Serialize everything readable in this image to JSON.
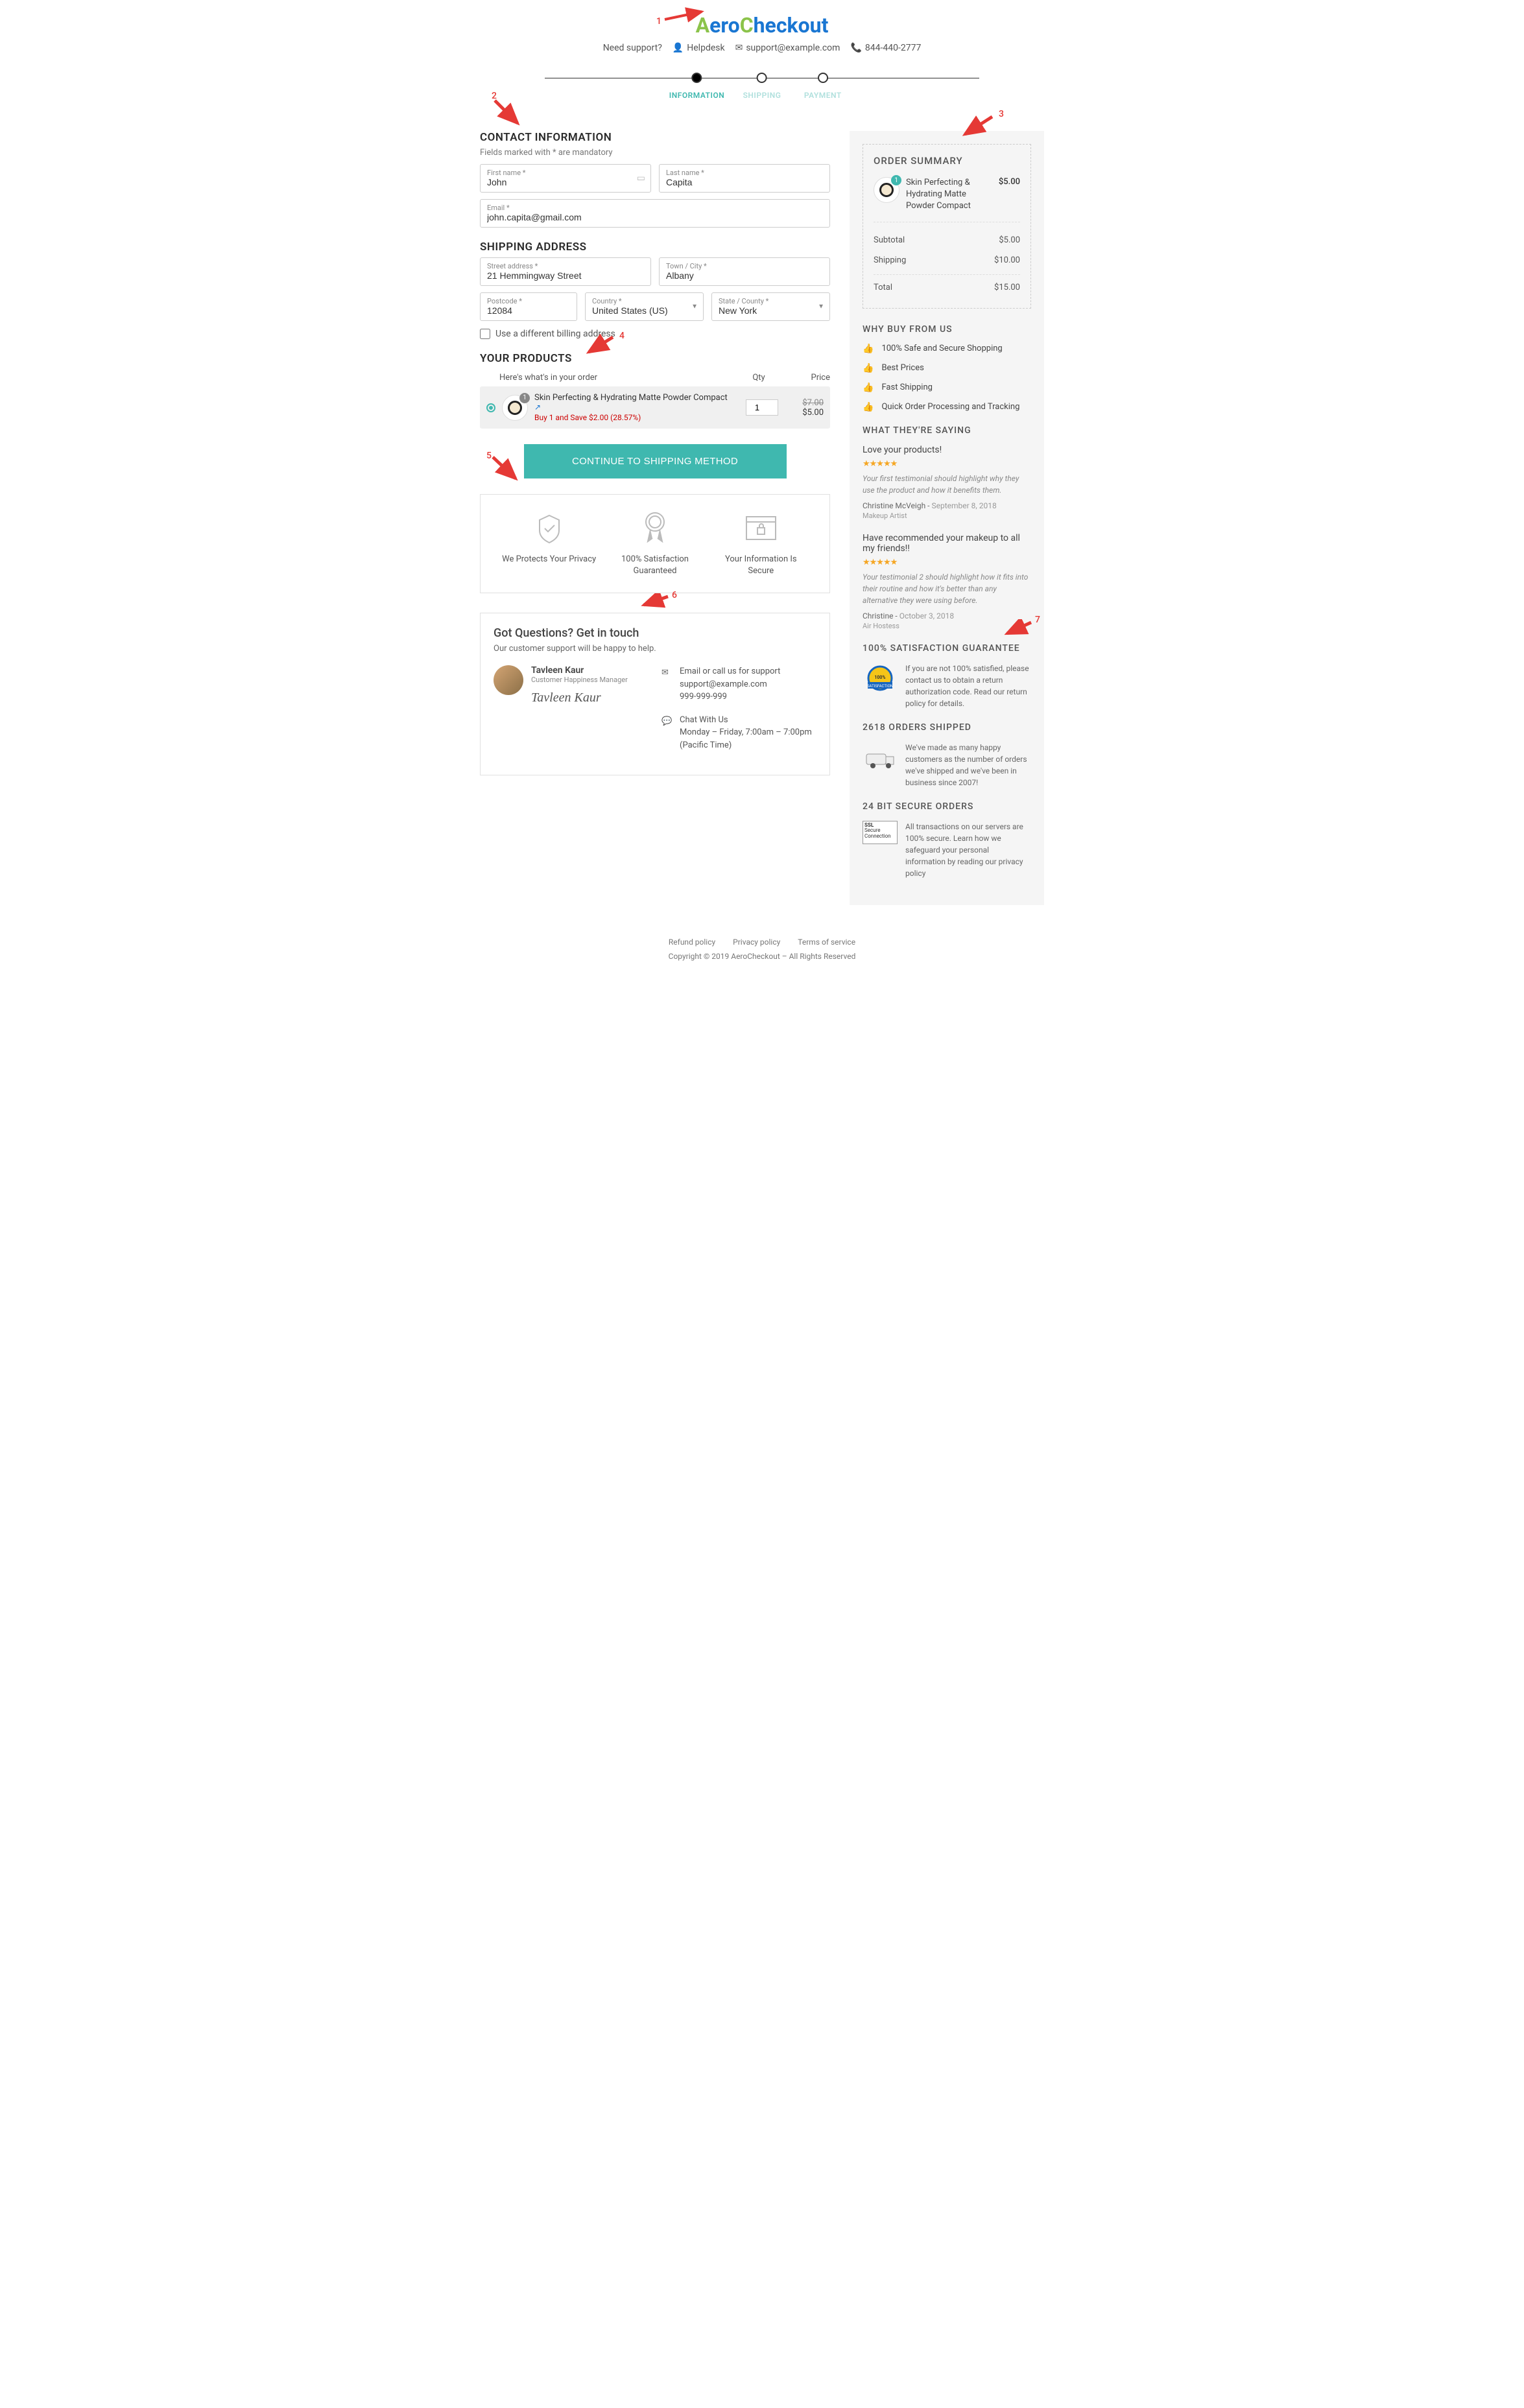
{
  "logo": {
    "a": "A",
    "rest1": "ero",
    "c": "C",
    "rest2": "heckout"
  },
  "support": {
    "need": "Need support?",
    "helpdesk": "Helpdesk",
    "email": "support@example.com",
    "phone": "844-440-2777"
  },
  "steps": {
    "s1": "INFORMATION",
    "s2": "SHIPPING",
    "s3": "PAYMENT"
  },
  "contact": {
    "title": "CONTACT INFORMATION",
    "hint": "Fields marked with * are mandatory",
    "fn_label": "First name *",
    "fn": "John",
    "ln_label": "Last name *",
    "ln": "Capita",
    "em_label": "Email *",
    "em": "john.capita@gmail.com"
  },
  "shipping": {
    "title": "SHIPPING ADDRESS",
    "street_label": "Street address *",
    "street": "21 Hemmingway Street",
    "city_label": "Town / City *",
    "city": "Albany",
    "zip_label": "Postcode *",
    "zip": "12084",
    "country_label": "Country *",
    "country": "United States (US)",
    "state_label": "State / County *",
    "state": "New York",
    "chk": "Use a different billing address"
  },
  "products": {
    "title": "YOUR PRODUCTS",
    "hint": "Here's what's in your order",
    "qty_h": "Qty",
    "price_h": "Price",
    "item": {
      "name": "Skin Perfecting & Hydrating Matte Powder Compact",
      "badge": "1",
      "deal": "Buy 1 and Save $2.00 (28.57%)",
      "qty": "1",
      "old": "$7.00",
      "new": "$5.00"
    }
  },
  "cta": "CONTINUE TO SHIPPING METHOD",
  "trust": {
    "t1": "We Protects Your Privacy",
    "t2": "100% Satisfaction Guaranteed",
    "t3": "Your Information Is Secure"
  },
  "contactbox": {
    "title": "Got Questions? Get in touch",
    "sub": "Our customer support will be happy to help.",
    "name": "Tavleen Kaur",
    "role": "Customer Happiness Manager",
    "sig": "Tavleen Kaur",
    "m1_t": "Email or call us for support",
    "m1_e": "support@example.com",
    "m1_p": "999-999-999",
    "m2_t": "Chat With Us",
    "m2_h": "Monday – Friday, 7:00am – 7:00pm (Pacific Time)"
  },
  "summary": {
    "title": "ORDER SUMMARY",
    "badge": "1",
    "item": "Skin Perfecting & Hydrating Matte Powder Compact",
    "item_p": "$5.00",
    "sub_l": "Subtotal",
    "sub_v": "$5.00",
    "ship_l": "Shipping",
    "ship_v": "$10.00",
    "tot_l": "Total",
    "tot_v": "$15.00"
  },
  "why": {
    "title": "WHY BUY FROM US",
    "i1": "100% Safe and Secure Shopping",
    "i2": "Best Prices",
    "i3": "Fast Shipping",
    "i4": "Quick Order Processing and Tracking"
  },
  "say": {
    "title": "WHAT THEY'RE SAYING",
    "t1": {
      "title": "Love your products!",
      "body": "Your first testimonial should highlight why they use the product and how it benefits them.",
      "author": "Christine McVeigh",
      "date": "September 8, 2018",
      "role": "Makeup Artist"
    },
    "t2": {
      "title": "Have recommended your makeup to all my friends!!",
      "body": "Your testimonial 2 should highlight how it fits into their routine and how it's better than any alternative they were using before.",
      "author": "Christine",
      "date": "October 3, 2018",
      "role": "Air Hostess"
    }
  },
  "sat": {
    "title": "100% SATISFACTION GUARANTEE",
    "body": "If you are not 100% satisfied, please contact us to obtain a return authorization code. Read our return policy for details."
  },
  "ship_info": {
    "title": "2618 ORDERS SHIPPED",
    "body": "We've made as many happy customers as the number of orders we've shipped and we've been in business since 2007!"
  },
  "secure": {
    "title": "24 BIT SECURE ORDERS",
    "body": "All transactions on our servers are 100% secure. Learn how we safeguard your personal information by reading our privacy policy"
  },
  "footer": {
    "l1": "Refund policy",
    "l2": "Privacy policy",
    "l3": "Terms of service",
    "copy": "Copyright © 2019 AeroCheckout – All Rights Reserved"
  },
  "annot": {
    "n1": "1",
    "n2": "2",
    "n3": "3",
    "n4": "4",
    "n5": "5",
    "n6": "6",
    "n7": "7"
  }
}
